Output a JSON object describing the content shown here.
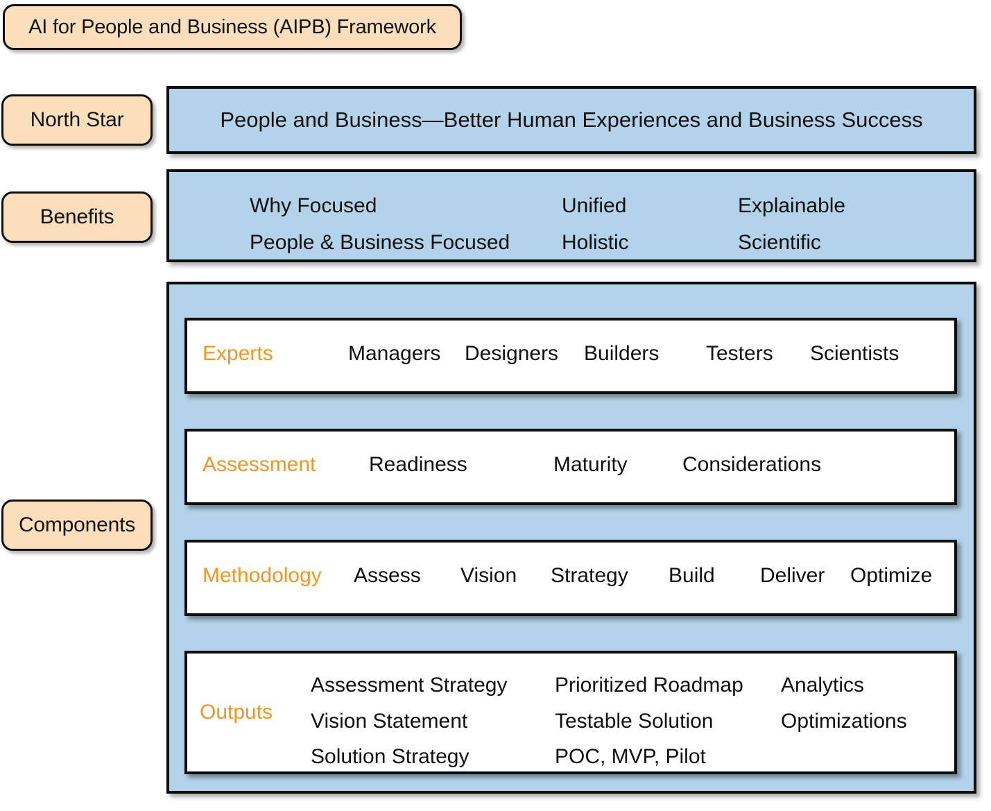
{
  "title": {
    "text": "AI for People and Business (AIPB) Framework"
  },
  "colors": {
    "peach_fill": "#fbdfba",
    "blue_fill": "#b2d3e9",
    "accent_orange": "#f7941e",
    "outline": "#0d0d0d",
    "text": "#101010",
    "row_fill": "#ffffff"
  },
  "labels": {
    "north_star": "North Star",
    "benefits": "Benefits",
    "components": "Components"
  },
  "north_star": {
    "statement": "People and Business—Better Human Experiences and Business Success"
  },
  "benefits": {
    "columns": [
      {
        "items": [
          "Why Focused",
          "People & Business Focused"
        ]
      },
      {
        "items": [
          "Unified",
          "Holistic"
        ]
      },
      {
        "items": [
          "Explainable",
          "Scientific"
        ]
      }
    ]
  },
  "components": {
    "rows": [
      {
        "label": "Experts",
        "items": [
          "Managers",
          "Designers",
          "Builders",
          "Testers",
          "Scientists"
        ],
        "offsets": [
          232,
          400,
          572,
          748,
          898
        ]
      },
      {
        "label": "Assessment",
        "items": [
          "Readiness",
          "Maturity",
          "Considerations"
        ],
        "offsets": [
          262,
          528,
          714
        ]
      },
      {
        "label": "Methodology",
        "items": [
          "Assess",
          "Vision",
          "Strategy",
          "Build",
          "Deliver",
          "Optimize"
        ],
        "offsets": [
          240,
          394,
          524,
          694,
          826,
          956
        ]
      }
    ],
    "outputs": {
      "label": "Outputs",
      "columns": [
        {
          "items": [
            "Assessment Strategy",
            "Vision Statement",
            "Solution Strategy"
          ]
        },
        {
          "items": [
            "Prioritized Roadmap",
            "Testable Solution",
            "POC, MVP, Pilot"
          ]
        },
        {
          "items": [
            "Analytics",
            "Optimizations"
          ]
        }
      ]
    }
  }
}
